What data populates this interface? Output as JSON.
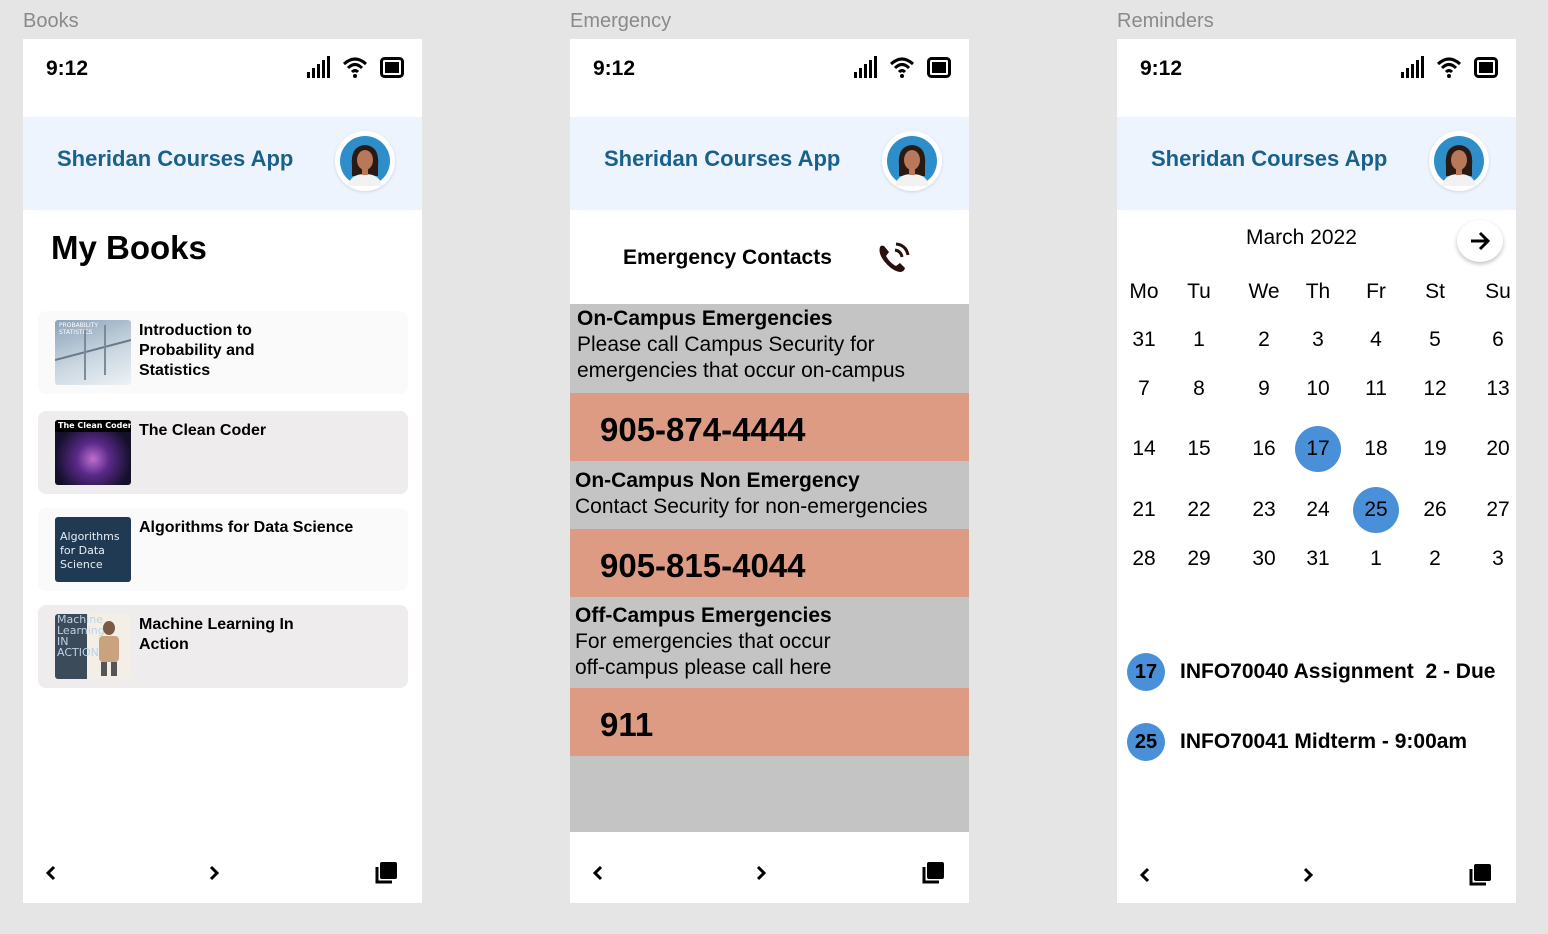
{
  "frames": {
    "books": "Books",
    "emergency": "Emergency",
    "reminders": "Reminders"
  },
  "status_time": "9:12",
  "app_title": "Sheridan Courses App",
  "icons": {
    "signal": "signal-icon",
    "wifi": "wifi-icon",
    "battery": "battery-icon",
    "back": "chevron-left-icon",
    "forward": "chevron-right-icon",
    "tabs": "copy-icon",
    "phone": "phone-ringing-icon",
    "next_month": "arrow-right-icon"
  },
  "books": {
    "heading": "My Books",
    "items": [
      {
        "title": "Introduction to Probability and Statistics",
        "cover_text": "PROBABILITY STATISTICS"
      },
      {
        "title": "The Clean Coder",
        "cover_text": "The Clean Coder"
      },
      {
        "title": "Algorithms for Data Science",
        "cover_text": "Algorithms for Data Science"
      },
      {
        "title": "Machine Learning In Action",
        "cover_text": "Machine Learning IN ACTION"
      }
    ]
  },
  "emergency": {
    "heading": "Emergency Contacts",
    "sections": [
      {
        "title": "On-Campus Emergencies",
        "desc1": "Please call Campus Security for",
        "desc2": "emergencies that occur on-campus",
        "number": "905-874-4444"
      },
      {
        "title": "On-Campus Non Emergency",
        "desc1": "Contact Security for non-emergencies",
        "desc2": "",
        "number": "905-815-4044"
      },
      {
        "title": "Off-Campus Emergencies",
        "desc1": "For emergencies that occur",
        "desc2": "off-campus please call here",
        "number": "911"
      }
    ]
  },
  "calendar": {
    "month": "March 2022",
    "weekdays": [
      "Mo",
      "Tu",
      "We",
      "Th",
      "Fr",
      "St",
      "Su"
    ],
    "weeks": [
      [
        "31",
        "1",
        "2",
        "3",
        "4",
        "5",
        "6"
      ],
      [
        "7",
        "8",
        "9",
        "10",
        "11",
        "12",
        "13"
      ],
      [
        "14",
        "15",
        "16",
        "17",
        "18",
        "19",
        "20"
      ],
      [
        "21",
        "22",
        "23",
        "24",
        "25",
        "26",
        "27"
      ],
      [
        "28",
        "29",
        "30",
        "31",
        "1",
        "2",
        "3"
      ]
    ],
    "highlighted": [
      "17",
      "25"
    ],
    "accent": "#4a90d9",
    "reminders": [
      {
        "day": "17",
        "text": "INFO70040 Assignment  2 - Due"
      },
      {
        "day": "25",
        "text": "INFO70041 Midterm - 9:00am"
      }
    ]
  }
}
